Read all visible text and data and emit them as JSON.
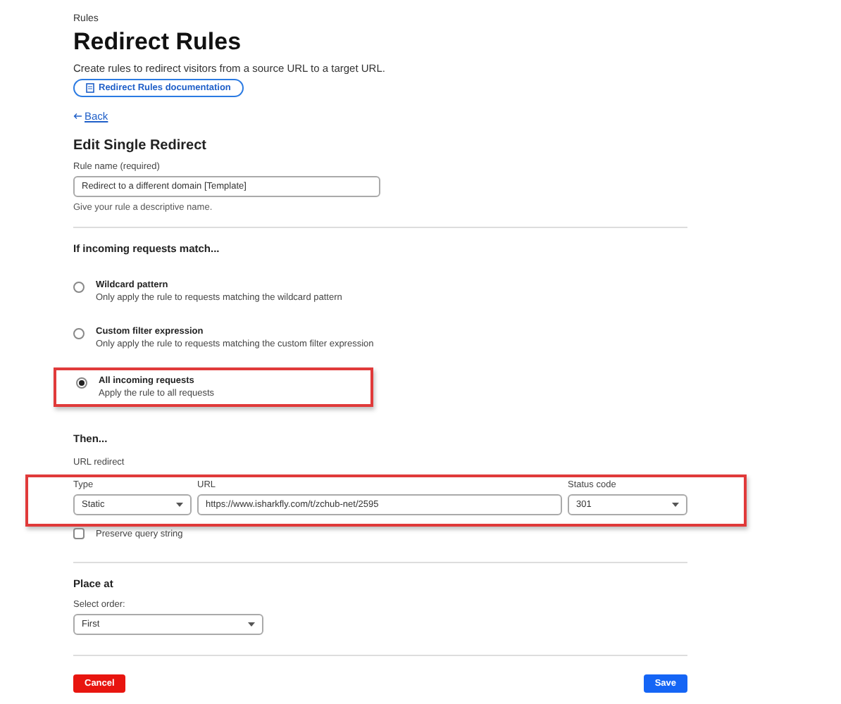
{
  "breadcrumb": "Rules",
  "title": "Redirect Rules",
  "description": "Create rules to redirect visitors from a source URL to a target URL.",
  "doc_link": "Redirect Rules documentation",
  "back_link": "Back",
  "section_title": "Edit Single Redirect",
  "rule_name": {
    "label": "Rule name (required)",
    "value": "Redirect to a different domain [Template]",
    "help": "Give your rule a descriptive name."
  },
  "match": {
    "title": "If incoming requests match...",
    "options": [
      {
        "label": "Wildcard pattern",
        "description": "Only apply the rule to requests matching the wildcard pattern",
        "selected": false,
        "highlighted": false
      },
      {
        "label": "Custom filter expression",
        "description": "Only apply the rule to requests matching the custom filter expression",
        "selected": false,
        "highlighted": false
      },
      {
        "label": "All incoming requests",
        "description": "Apply the rule to all requests",
        "selected": true,
        "highlighted": true
      }
    ]
  },
  "then": {
    "title": "Then...",
    "subtitle": "URL redirect",
    "highlighted": true,
    "type": {
      "label": "Type",
      "value": "Static"
    },
    "url": {
      "label": "URL",
      "value": "https://www.isharkfly.com/t/zchub-net/2595"
    },
    "status_code": {
      "label": "Status code",
      "value": "301"
    },
    "preserve_query": {
      "label": "Preserve query string",
      "checked": false
    }
  },
  "place_at": {
    "title": "Place at",
    "label": "Select order:",
    "value": "First"
  },
  "buttons": {
    "cancel": "Cancel",
    "save": "Save"
  }
}
